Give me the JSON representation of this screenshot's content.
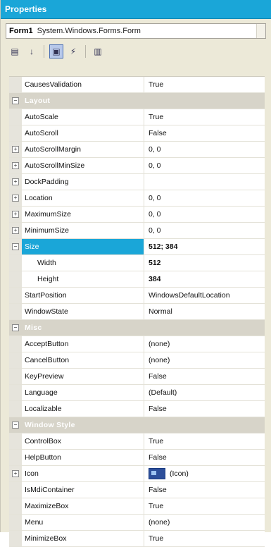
{
  "window": {
    "title": "Properties"
  },
  "selector": {
    "object_name": "Form1",
    "object_type": "System.Windows.Forms.Form"
  },
  "toolbar": {
    "buttons": [
      {
        "name": "categorized-icon",
        "glyph": "▤"
      },
      {
        "name": "alphabetical-icon",
        "glyph": "↓"
      },
      {
        "name": "properties-icon",
        "glyph": "▣"
      },
      {
        "name": "events-icon",
        "glyph": "⚡"
      },
      {
        "name": "property-pages-icon",
        "glyph": "▥"
      }
    ]
  },
  "rows": [
    {
      "type": "prop",
      "name": "CausesValidation",
      "value": "True"
    },
    {
      "type": "cat",
      "name": "Layout"
    },
    {
      "type": "prop",
      "name": "AutoScale",
      "value": "True"
    },
    {
      "type": "prop",
      "name": "AutoScroll",
      "value": "False"
    },
    {
      "type": "prop",
      "name": "AutoScrollMargin",
      "value": "0, 0",
      "expand": "+"
    },
    {
      "type": "prop",
      "name": "AutoScrollMinSize",
      "value": "0, 0",
      "expand": "+"
    },
    {
      "type": "prop",
      "name": "DockPadding",
      "value": "",
      "expand": "+"
    },
    {
      "type": "prop",
      "name": "Location",
      "value": "0, 0",
      "expand": "+"
    },
    {
      "type": "prop",
      "name": "MaximumSize",
      "value": "0, 0",
      "expand": "+"
    },
    {
      "type": "prop",
      "name": "MinimumSize",
      "value": "0, 0",
      "expand": "+"
    },
    {
      "type": "prop",
      "name": "Size",
      "value": "512; 384",
      "expand": "−",
      "selected": true,
      "bold": true
    },
    {
      "type": "prop",
      "name": "Width",
      "value": "512",
      "indent": true,
      "bold": true
    },
    {
      "type": "prop",
      "name": "Height",
      "value": "384",
      "indent": true,
      "bold": true
    },
    {
      "type": "prop",
      "name": "StartPosition",
      "value": "WindowsDefaultLocation"
    },
    {
      "type": "prop",
      "name": "WindowState",
      "value": "Normal"
    },
    {
      "type": "cat",
      "name": "Misc"
    },
    {
      "type": "prop",
      "name": "AcceptButton",
      "value": "(none)"
    },
    {
      "type": "prop",
      "name": "CancelButton",
      "value": "(none)"
    },
    {
      "type": "prop",
      "name": "KeyPreview",
      "value": "False"
    },
    {
      "type": "prop",
      "name": "Language",
      "value": "(Default)"
    },
    {
      "type": "prop",
      "name": "Localizable",
      "value": "False"
    },
    {
      "type": "cat",
      "name": "Window Style"
    },
    {
      "type": "prop",
      "name": "ControlBox",
      "value": "True"
    },
    {
      "type": "prop",
      "name": "HelpButton",
      "value": "False"
    },
    {
      "type": "prop",
      "name": "Icon",
      "value": "(Icon)",
      "expand": "+",
      "icon": true
    },
    {
      "type": "prop",
      "name": "IsMdiContainer",
      "value": "False"
    },
    {
      "type": "prop",
      "name": "MaximizeBox",
      "value": "True"
    },
    {
      "type": "prop",
      "name": "Menu",
      "value": "(none)"
    },
    {
      "type": "prop",
      "name": "MinimizeBox",
      "value": "True"
    }
  ],
  "colors": {
    "title_bar": "#1aa6d8",
    "selection": "#1aa6d8",
    "category": "#d7d4c9"
  }
}
